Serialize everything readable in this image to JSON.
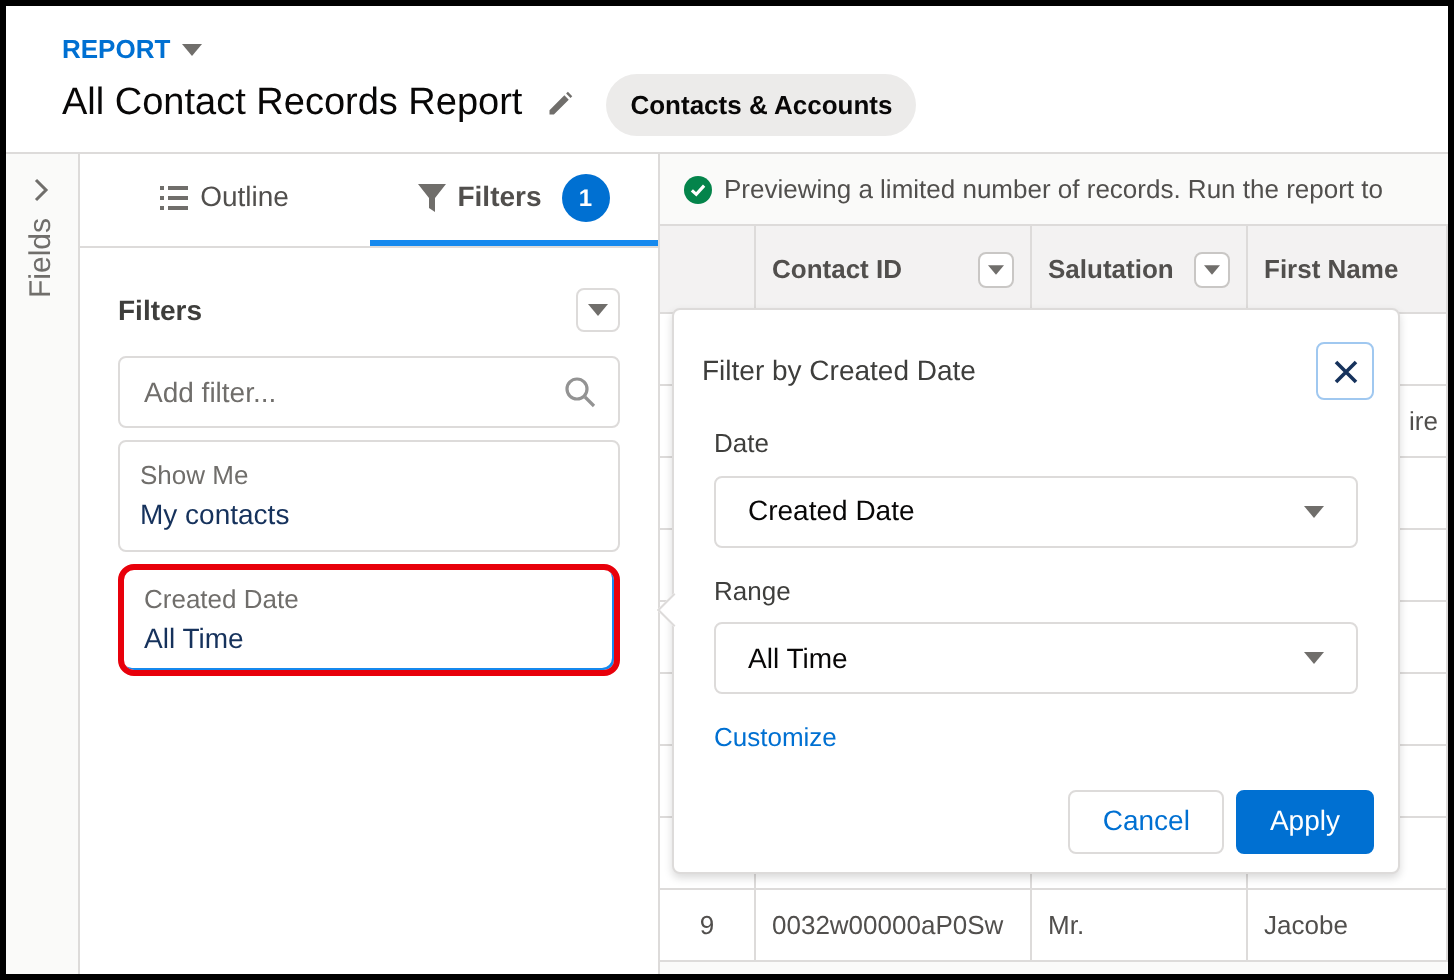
{
  "header": {
    "object_label": "REPORT",
    "title": "All Contact Records Report",
    "report_type": "Contacts & Accounts"
  },
  "side_strip": {
    "label": "Fields"
  },
  "tabs": [
    {
      "label": "Outline",
      "selected": false
    },
    {
      "label": "Filters",
      "selected": true,
      "count": "1"
    }
  ],
  "filters_panel": {
    "title": "Filters",
    "search": {
      "placeholder": "Add filter..."
    },
    "filters": [
      {
        "label": "Show Me",
        "value": "My contacts",
        "highlighted": false
      },
      {
        "label": "Created Date",
        "value": "All Time",
        "highlighted": true
      }
    ]
  },
  "table": {
    "notice": "Previewing a limited number of records. Run the report to",
    "columns": [
      "Contact ID",
      "Salutation",
      "First Name"
    ],
    "rows": [
      {
        "first_name": "ire"
      },
      {
        "number": "9",
        "contact_id": "0032w00000aP0Sw",
        "salutation": "Mr.",
        "first_name": "Jacobe"
      }
    ]
  },
  "popover": {
    "title": "Filter by Created Date",
    "fields": [
      {
        "label": "Date",
        "value": "Created Date"
      },
      {
        "label": "Range",
        "value": "All Time"
      }
    ],
    "link": "Customize",
    "buttons": [
      {
        "label": "Cancel",
        "kind": "neutral"
      },
      {
        "label": "Apply",
        "kind": "brand"
      }
    ]
  }
}
